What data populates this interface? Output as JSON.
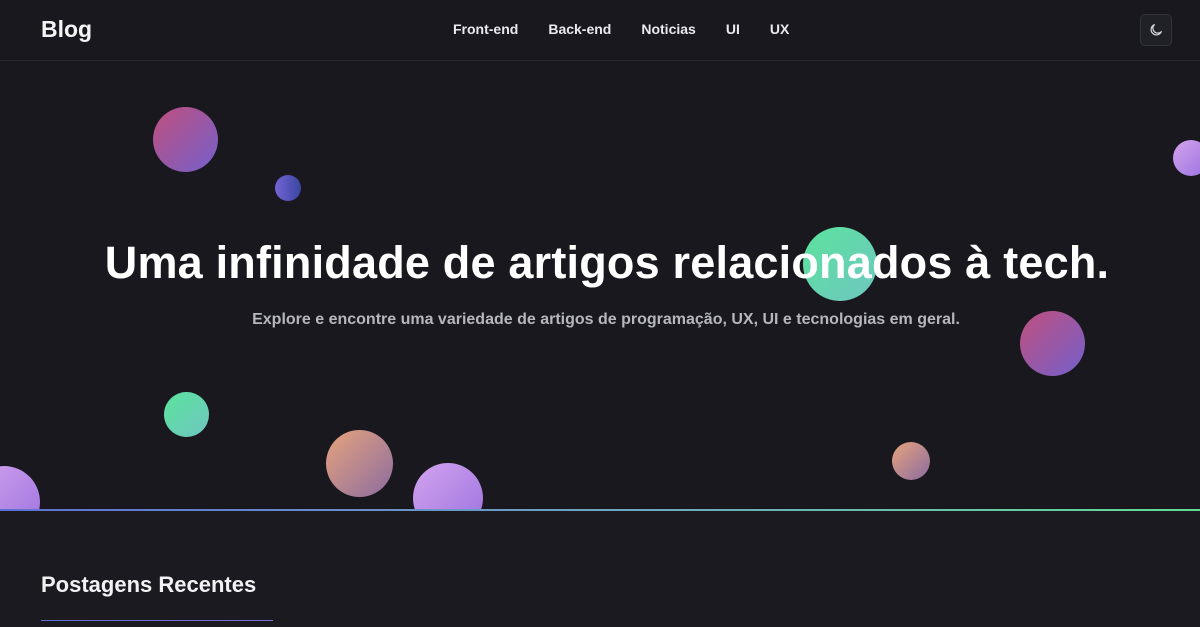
{
  "navbar": {
    "brand": "Blog",
    "links": [
      "Front-end",
      "Back-end",
      "Noticias",
      "UI",
      "UX"
    ],
    "theme_toggle_icon": "moon-icon"
  },
  "hero": {
    "title": "Uma infinidade de artigos relacionados à tech.",
    "subtitle": "Explore e encontre uma variedade de artigos de programação, UX, UI e tecnologias em geral."
  },
  "recent_posts": {
    "heading": "Postagens Recentes"
  },
  "colors": {
    "background": "#18181e",
    "accent_blue": "#5f6fd4",
    "accent_green": "#62dc94"
  }
}
